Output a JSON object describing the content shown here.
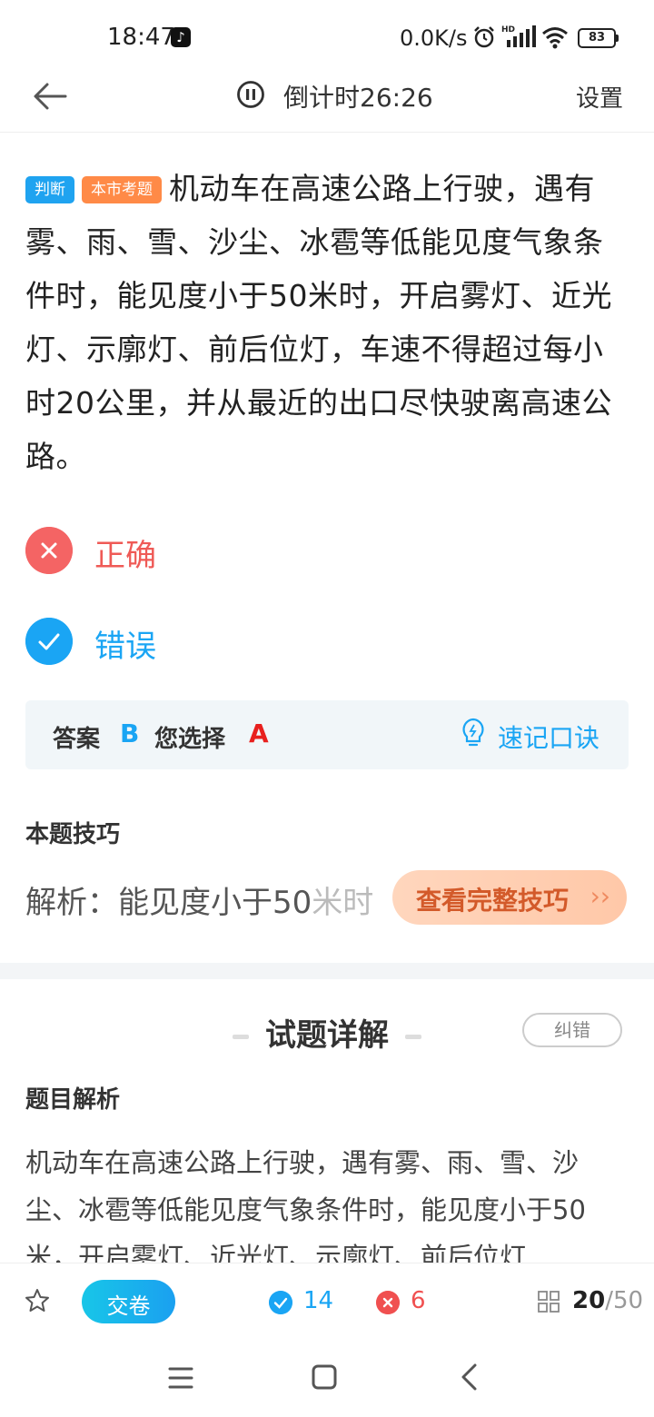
{
  "status_bar": {
    "time": "18:47",
    "app_icon": "tiktok-icon",
    "net_speed": "0.0K/s",
    "battery": "83"
  },
  "header": {
    "timer": "倒计时26:26",
    "settings": "设置"
  },
  "question": {
    "type_tag": "判断",
    "source_tag": "本市考题",
    "text": "机动车在高速公路上行驶，遇有雾、雨、雪、沙尘、冰雹等低能见度气象条件时，能见度小于50米时，开启雾灯、近光灯、示廓灯、前后位灯，车速不得超过每小时20公里，并从最近的出口尽快驶离高速公路。"
  },
  "options": [
    {
      "label": "正确",
      "state": "selected-wrong",
      "icon": "close-icon"
    },
    {
      "label": "错误",
      "state": "correct",
      "icon": "check-icon"
    }
  ],
  "answer": {
    "answer_label": "答案",
    "answer_value": "B",
    "choice_label": "您选择",
    "choice_value": "A",
    "mnemonic": "速记口诀"
  },
  "tips": {
    "title": "本题技巧",
    "preview": "解析：能见度小于50",
    "preview_fade": "米时",
    "button": "查看完整技巧",
    "chevron": "››"
  },
  "detail": {
    "title": "试题详解",
    "report": "纠错",
    "heading": "题目解析",
    "body": "机动车在高速公路上行驶，遇有雾、雨、雪、沙尘、冰雹等低能见度气象条件时，能见度小于50米，开启雾灯、近光灯、示廓灯、前后位灯"
  },
  "toolbar": {
    "submit": "交卷",
    "right_count": "14",
    "wrong_count": "6",
    "current": "20",
    "total": "/50"
  },
  "colors": {
    "accent": "#1aa5f4",
    "wrong": "#f05050",
    "orange": "#ff8a47"
  }
}
